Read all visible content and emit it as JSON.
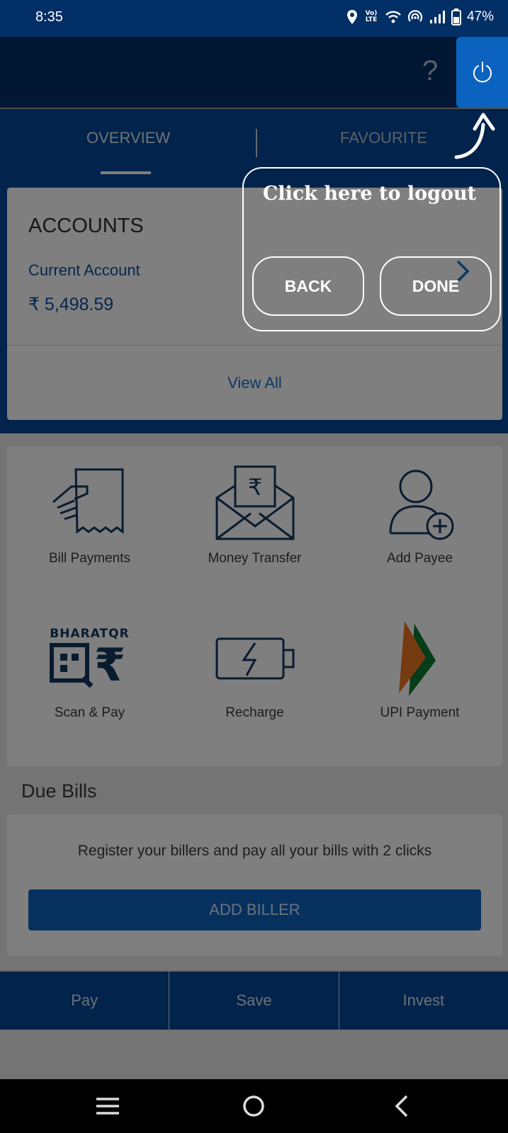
{
  "status_bar": {
    "time": "8:35",
    "volte": "Vo) LTE",
    "battery": "47%"
  },
  "header": {
    "help_icon": "?"
  },
  "tabs": [
    {
      "label": "OVERVIEW"
    },
    {
      "label": "FAVOURITE"
    }
  ],
  "accounts": {
    "title": "ACCOUNTS",
    "account_name": "Current Account",
    "balance": "₹ 5,498.59",
    "view_all": "View All"
  },
  "services": [
    {
      "label": "Bill Payments",
      "icon": "bill-payments-icon"
    },
    {
      "label": "Money Transfer",
      "icon": "money-transfer-icon"
    },
    {
      "label": "Add Payee",
      "icon": "add-payee-icon"
    },
    {
      "label": "Scan & Pay",
      "icon": "bharatqr-icon",
      "logo_text": "BHARATQR"
    },
    {
      "label": "Recharge",
      "icon": "battery-charge-icon"
    },
    {
      "label": "UPI Payment",
      "icon": "upi-logo-icon"
    }
  ],
  "due_bills": {
    "title": "Due Bills",
    "message": "Register your billers and pay all your bills with 2 clicks",
    "button": "ADD BILLER"
  },
  "bottom_nav": [
    {
      "label": "Pay"
    },
    {
      "label": "Save"
    },
    {
      "label": "Invest"
    }
  ],
  "tooltip": {
    "text": "Click here to logout",
    "back": "BACK",
    "done": "DONE"
  },
  "colors": {
    "primary": "#044696",
    "header": "#022f66",
    "accent": "#0c63bf"
  }
}
